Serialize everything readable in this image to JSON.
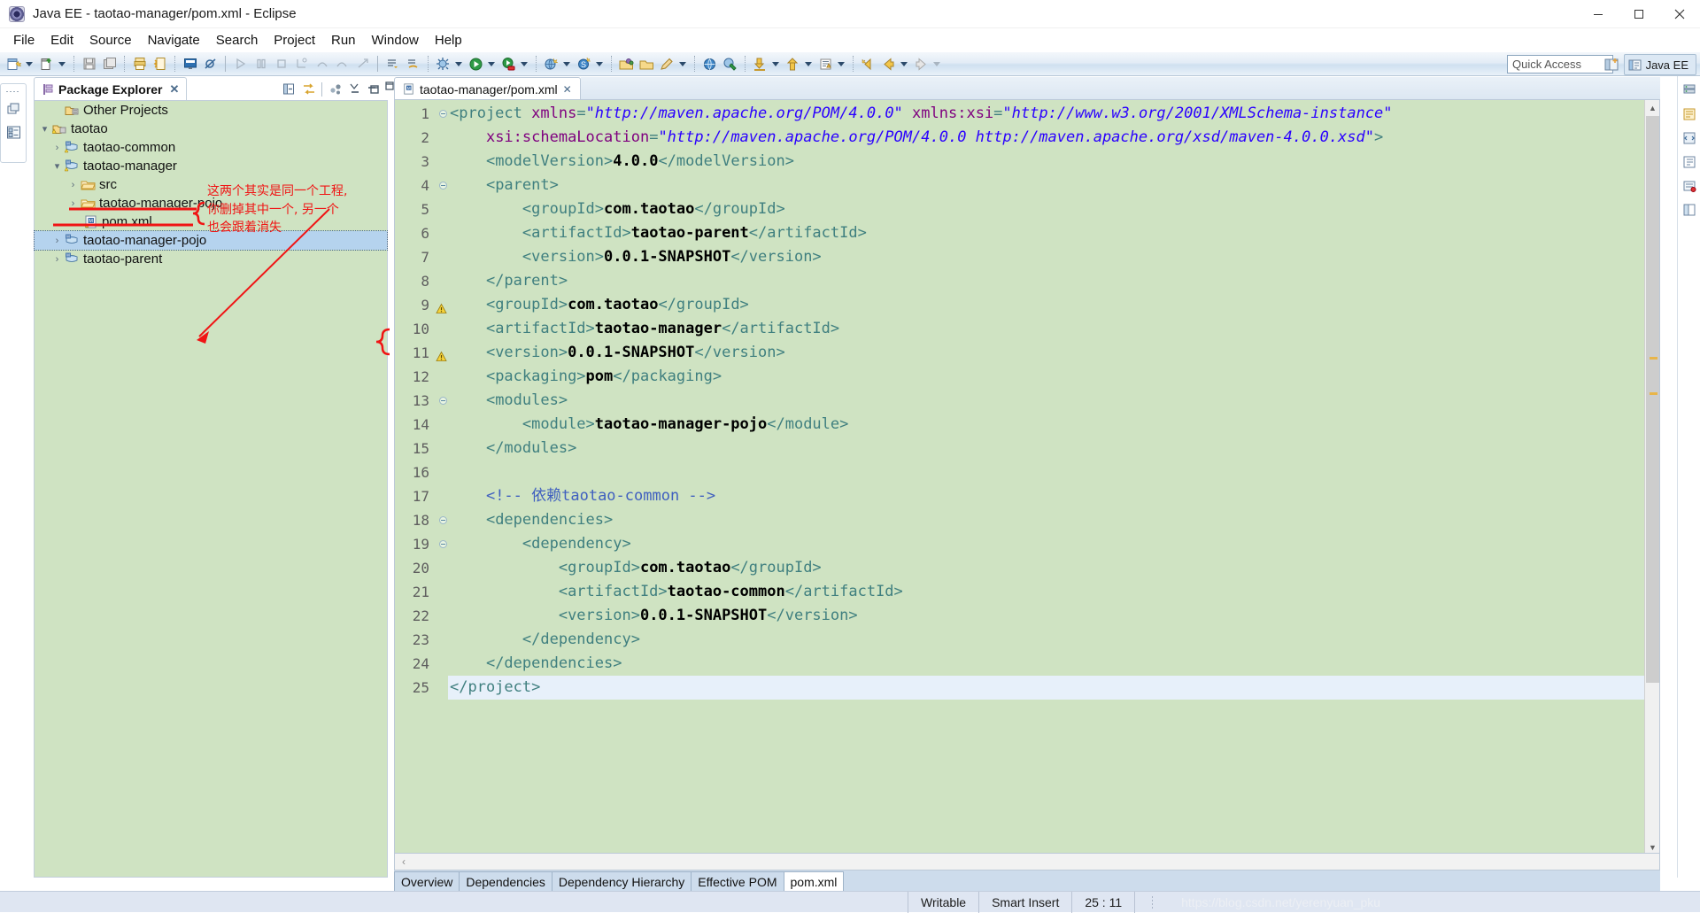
{
  "window": {
    "title": "Java EE - taotao-manager/pom.xml - Eclipse",
    "app_icon": "eclipse-icon",
    "minimize": "minimize-icon",
    "maximize": "maximize-icon",
    "close": "close-icon"
  },
  "menu": [
    {
      "label": "File"
    },
    {
      "label": "Edit"
    },
    {
      "label": "Source"
    },
    {
      "label": "Navigate"
    },
    {
      "label": "Search"
    },
    {
      "label": "Project"
    },
    {
      "label": "Run"
    },
    {
      "label": "Window"
    },
    {
      "label": "Help"
    }
  ],
  "toolbar": {
    "quick_access_placeholder": "Quick Access",
    "perspective_label": "Java EE",
    "icons": [
      "new-wizard-icon",
      "new-dropdown-caret",
      "new-file-icon",
      "new-file-dropdown-caret",
      "save-icon",
      "save-all-icon",
      "print-icon",
      "export-icon",
      "console-icon",
      "skip-breakpoints-icon",
      "run-icon-disabled",
      "pause-icon-disabled",
      "stop-icon-disabled",
      "step-into-icon-disabled",
      "step-over-icon-disabled",
      "step-return-icon-disabled",
      "resume-icon-disabled",
      "open-task-icon",
      "new-task-icon",
      "debug-icon",
      "debug-dropdown-caret",
      "run-as-icon",
      "run-dropdown-caret",
      "run-server-icon",
      "run-server-dropdown-caret",
      "open-web-browser-icon",
      "browser-dropdown-caret",
      "search-icon",
      "search-dropdown-caret",
      "open-type-icon",
      "open-resource-icon",
      "new-annotation-icon",
      "annotation-dropdown-caret",
      "globe-icon",
      "validate-icon",
      "download-icon",
      "download-dropdown-caret",
      "upload-icon",
      "upload-dropdown-caret",
      "publish-icon",
      "publish-dropdown-caret",
      "previous-annotation-icon",
      "back-icon",
      "back-dropdown-caret",
      "forward-icon",
      "forward-dropdown-caret"
    ]
  },
  "package_explorer": {
    "tab_label": "Package Explorer",
    "tab_icon": "package-explorer-icon",
    "close_icon": "close-tab-icon",
    "view_toolbar": [
      "collapse-all-icon",
      "link-with-editor-icon",
      "view-menu-icon"
    ],
    "minimize_icon": "minimize-view-icon",
    "maximize_icon": "maximize-view-icon",
    "tree": [
      {
        "label": "Other Projects",
        "icon": "working-set-icon",
        "twisty": "",
        "depth": 1,
        "selected": false
      },
      {
        "label": "taotao",
        "icon": "working-set-warning-icon",
        "twisty": "v",
        "depth": 0,
        "selected": false
      },
      {
        "label": "taotao-common",
        "icon": "maven-project-icon",
        "twisty": ">",
        "depth": 1,
        "selected": false
      },
      {
        "label": "taotao-manager",
        "icon": "maven-project-icon",
        "twisty": "v",
        "depth": 1,
        "selected": false
      },
      {
        "label": "src",
        "icon": "folder-icon",
        "twisty": ">",
        "depth": 2,
        "selected": false
      },
      {
        "label": "taotao-manager-pojo",
        "icon": "folder-icon",
        "twisty": ">",
        "depth": 2,
        "selected": false
      },
      {
        "label": "pom.xml",
        "icon": "pom-file-icon",
        "twisty": "",
        "depth": 3,
        "selected": false
      },
      {
        "label": "taotao-manager-pojo",
        "icon": "maven-project-icon",
        "twisty": ">",
        "depth": 1,
        "selected": true
      },
      {
        "label": "taotao-parent",
        "icon": "maven-project-icon",
        "twisty": ">",
        "depth": 1,
        "selected": false
      }
    ]
  },
  "annotation": {
    "line1": "这两个其实是同一个工程,",
    "line2": "你删掉其中一个, 另一个",
    "line3": "也会跟着消失",
    "color": "#f01414"
  },
  "editor": {
    "tab_label": "taotao-manager/pom.xml",
    "tab_icon": "pom-file-icon",
    "tab_close_icon": "close-tab-icon",
    "minimize_icon": "minimize-editor-icon",
    "maximize_icon": "maximize-editor-icon",
    "view_menu_icon": "editor-view-menu-icon",
    "bottom_tabs": [
      {
        "label": "Overview",
        "active": false
      },
      {
        "label": "Dependencies",
        "active": false
      },
      {
        "label": "Dependency Hierarchy",
        "active": false
      },
      {
        "label": "Effective POM",
        "active": false
      },
      {
        "label": "pom.xml",
        "active": true
      }
    ],
    "hscroll_left_icon": "scroll-left-icon",
    "lines": [
      {
        "n": 1,
        "fold": true,
        "marker": "",
        "current": false,
        "html": "<span class=\"tag\">&lt;project </span><span class=\"attr\">xmlns</span><span class=\"tag\">=</span><span class=\"val\">\"http://maven.apache.org/POM/4.0.0\"</span><span class=\"tag\"> </span><span class=\"attr\">xmlns:xsi</span><span class=\"tag\">=</span><span class=\"val\">\"http://www.w3.org/2001/XMLSchema-instance\"</span>"
      },
      {
        "n": 2,
        "fold": false,
        "marker": "",
        "current": false,
        "html": "    <span class=\"attr\">xsi:schemaLocation</span><span class=\"tag\">=</span><span class=\"val\">\"http://maven.apache.org/POM/4.0.0 http://maven.apache.org/xsd/maven-4.0.0.xsd\"</span><span class=\"tag\">&gt;</span>"
      },
      {
        "n": 3,
        "fold": false,
        "marker": "",
        "current": false,
        "html": "    <span class=\"tag\">&lt;modelVersion&gt;</span><span class=\"txt\">4.0.0</span><span class=\"tag\">&lt;/modelVersion&gt;</span>"
      },
      {
        "n": 4,
        "fold": true,
        "marker": "",
        "current": false,
        "html": "    <span class=\"tag\">&lt;parent&gt;</span>"
      },
      {
        "n": 5,
        "fold": false,
        "marker": "",
        "current": false,
        "html": "        <span class=\"tag\">&lt;groupId&gt;</span><span class=\"txt\">com.taotao</span><span class=\"tag\">&lt;/groupId&gt;</span>"
      },
      {
        "n": 6,
        "fold": false,
        "marker": "",
        "current": false,
        "html": "        <span class=\"tag\">&lt;artifactId&gt;</span><span class=\"txt\">taotao-parent</span><span class=\"tag\">&lt;/artifactId&gt;</span>"
      },
      {
        "n": 7,
        "fold": false,
        "marker": "",
        "current": false,
        "html": "        <span class=\"tag\">&lt;version&gt;</span><span class=\"txt\">0.0.1-SNAPSHOT</span><span class=\"tag\">&lt;/version&gt;</span>"
      },
      {
        "n": 8,
        "fold": false,
        "marker": "",
        "current": false,
        "html": "    <span class=\"tag\">&lt;/parent&gt;</span>"
      },
      {
        "n": 9,
        "fold": false,
        "marker": "warning",
        "current": false,
        "html": "    <span class=\"tag\">&lt;groupId&gt;</span><span class=\"txt\">com.taotao</span><span class=\"tag\">&lt;/groupId&gt;</span>"
      },
      {
        "n": 10,
        "fold": false,
        "marker": "",
        "current": false,
        "html": "    <span class=\"tag\">&lt;artifactId&gt;</span><span class=\"txt\">taotao-manager</span><span class=\"tag\">&lt;/artifactId&gt;</span>"
      },
      {
        "n": 11,
        "fold": false,
        "marker": "warning",
        "current": false,
        "html": "    <span class=\"tag\">&lt;version&gt;</span><span class=\"txt\">0.0.1-SNAPSHOT</span><span class=\"tag\">&lt;/version&gt;</span>"
      },
      {
        "n": 12,
        "fold": false,
        "marker": "",
        "current": false,
        "html": "    <span class=\"tag\">&lt;packaging&gt;</span><span class=\"txt\">pom</span><span class=\"tag\">&lt;/packaging&gt;</span>"
      },
      {
        "n": 13,
        "fold": true,
        "marker": "",
        "current": false,
        "html": "    <span class=\"tag\">&lt;modules&gt;</span>"
      },
      {
        "n": 14,
        "fold": false,
        "marker": "",
        "current": false,
        "html": "        <span class=\"tag\">&lt;module&gt;</span><span class=\"txt\">taotao-manager-pojo</span><span class=\"tag\">&lt;/module&gt;</span>"
      },
      {
        "n": 15,
        "fold": false,
        "marker": "",
        "current": false,
        "html": "    <span class=\"tag\">&lt;/modules&gt;</span>"
      },
      {
        "n": 16,
        "fold": false,
        "marker": "",
        "current": false,
        "html": ""
      },
      {
        "n": 17,
        "fold": false,
        "marker": "",
        "current": false,
        "html": "    <span class=\"cmt\">&lt;!-- 依赖taotao-common --&gt;</span>"
      },
      {
        "n": 18,
        "fold": true,
        "marker": "",
        "current": false,
        "html": "    <span class=\"tag\">&lt;dependencies&gt;</span>"
      },
      {
        "n": 19,
        "fold": true,
        "marker": "",
        "current": false,
        "html": "        <span class=\"tag\">&lt;dependency&gt;</span>"
      },
      {
        "n": 20,
        "fold": false,
        "marker": "",
        "current": false,
        "html": "            <span class=\"tag\">&lt;groupId&gt;</span><span class=\"txt\">com.taotao</span><span class=\"tag\">&lt;/groupId&gt;</span>"
      },
      {
        "n": 21,
        "fold": false,
        "marker": "",
        "current": false,
        "html": "            <span class=\"tag\">&lt;artifactId&gt;</span><span class=\"txt\">taotao-common</span><span class=\"tag\">&lt;/artifactId&gt;</span>"
      },
      {
        "n": 22,
        "fold": false,
        "marker": "",
        "current": false,
        "html": "            <span class=\"tag\">&lt;version&gt;</span><span class=\"txt\">0.0.1-SNAPSHOT</span><span class=\"tag\">&lt;/version&gt;</span>"
      },
      {
        "n": 23,
        "fold": false,
        "marker": "",
        "current": false,
        "html": "        <span class=\"tag\">&lt;/dependency&gt;</span>"
      },
      {
        "n": 24,
        "fold": false,
        "marker": "",
        "current": false,
        "html": "    <span class=\"tag\">&lt;/dependencies&gt;</span>"
      },
      {
        "n": 25,
        "fold": false,
        "marker": "",
        "current": true,
        "html": "<span class=\"tag\">&lt;/project&gt;</span>"
      }
    ]
  },
  "status_bar": {
    "writable": "Writable",
    "insert_mode": "Smart Insert",
    "cursor_position": "25 : 11",
    "watermark": "https://blog.csdn.net/yerenyuan_pku"
  },
  "right_bar": [
    "server-icon",
    "palette-icon",
    "snippets-icon",
    "outline-icon",
    "markers-icon",
    "properties-icon"
  ]
}
